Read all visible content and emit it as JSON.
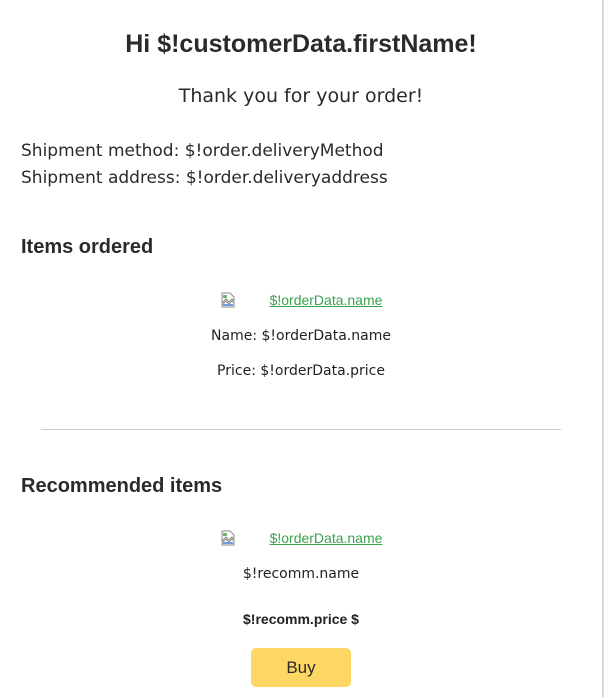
{
  "header": {
    "greeting": "Hi $!customerData.firstName!",
    "thanks": "Thank you for your order!"
  },
  "shipment": {
    "method": "Shipment method: $!order.deliveryMethod",
    "address": "Shipment address: $!order.deliveryaddress"
  },
  "items_ordered": {
    "title": "Items ordered",
    "image_link": "$!orderData.name",
    "name": "Name: $!orderData.name",
    "price": "Price: $!orderData.price"
  },
  "recommended": {
    "title": "Recommended items",
    "image_link": "$!orderData.name",
    "name": "$!recomm.name",
    "price": "$!recomm.price $",
    "buy_label": "Buy"
  },
  "colors": {
    "link": "#3aa24f",
    "buy_button": "#fdd663",
    "divider": "#cccccc"
  },
  "icons": {
    "broken_image": "broken-image-icon"
  }
}
